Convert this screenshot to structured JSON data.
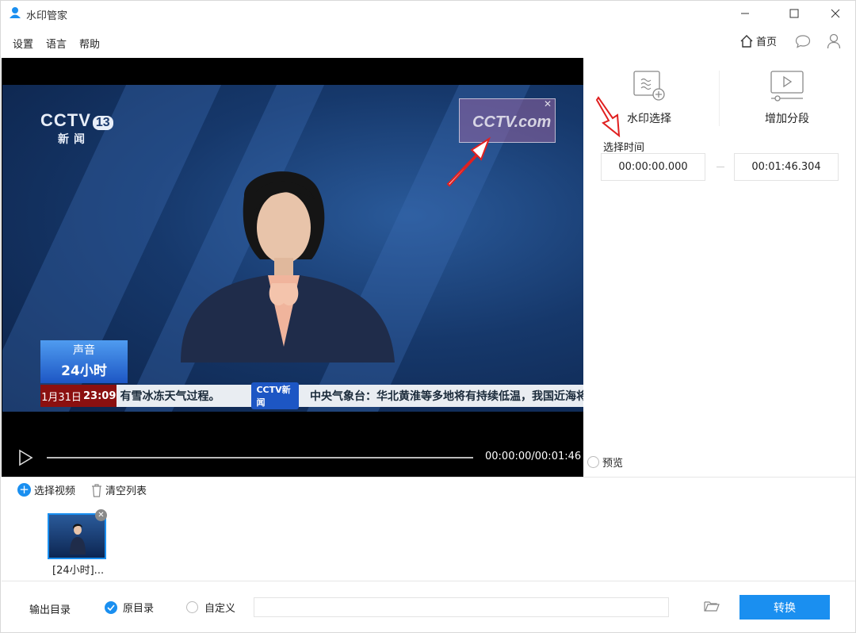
{
  "app": {
    "title": "水印管家"
  },
  "window": {
    "min_icon": "minimize-icon",
    "max_icon": "maximize-icon",
    "close_icon": "close-icon"
  },
  "menu": {
    "items": [
      "设置",
      "语言",
      "帮助"
    ],
    "home_label": "首页"
  },
  "video": {
    "channel": "CCTV",
    "channel_number": "13",
    "channel_sub": "新闻",
    "watermark": "CCTV.com",
    "badge_top": "声音",
    "badge_bottom": "24小时",
    "ticker_date": "1月31日",
    "ticker_time": "23:09",
    "ticker_text_1": "有雪冰冻天气过程。",
    "ticker_logo": "CCTV新闻",
    "ticker_text_2": "中央气象台：华北黄淮等多地将有持续低温，我国近海将",
    "time": "00:00:00/00:01:46",
    "progress": 0
  },
  "tools": {
    "watermark_select": "水印选择",
    "add_segment": "增加分段"
  },
  "time_select": {
    "label": "选择时间",
    "start": "00:00:00.000",
    "end": "00:01:46.304"
  },
  "preview": {
    "label": "预览"
  },
  "files": {
    "add_label": "选择视频",
    "clear_label": "清空列表",
    "items": [
      {
        "name": "[24小时]..."
      }
    ]
  },
  "output": {
    "label": "输出目录",
    "option_original": "原目录",
    "option_custom": "自定义",
    "path": "",
    "convert": "转换"
  },
  "colors": {
    "accent": "#1a8ff0"
  }
}
